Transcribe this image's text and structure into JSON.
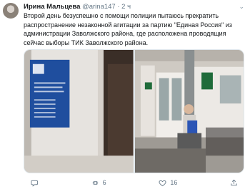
{
  "tweet": {
    "author_name": "Ирина Мальцева",
    "handle": "@arina147",
    "separator": "·",
    "time": "2 ч",
    "text": "Второй день безуспешно  с помощи полиции пытаюсь прекратить распространение незаконной агитации за партию \"Единая Россия\" из администрации Заволжского района, где расположена проводящия сейчас выборы ТИК Заволжского района."
  },
  "actions": {
    "retweet_count": "6",
    "like_count": "16"
  },
  "colors": {
    "text": "#14171a",
    "muted": "#657786",
    "sign_blue": "#1f4e9e",
    "sign_green": "#1f6b3a"
  }
}
